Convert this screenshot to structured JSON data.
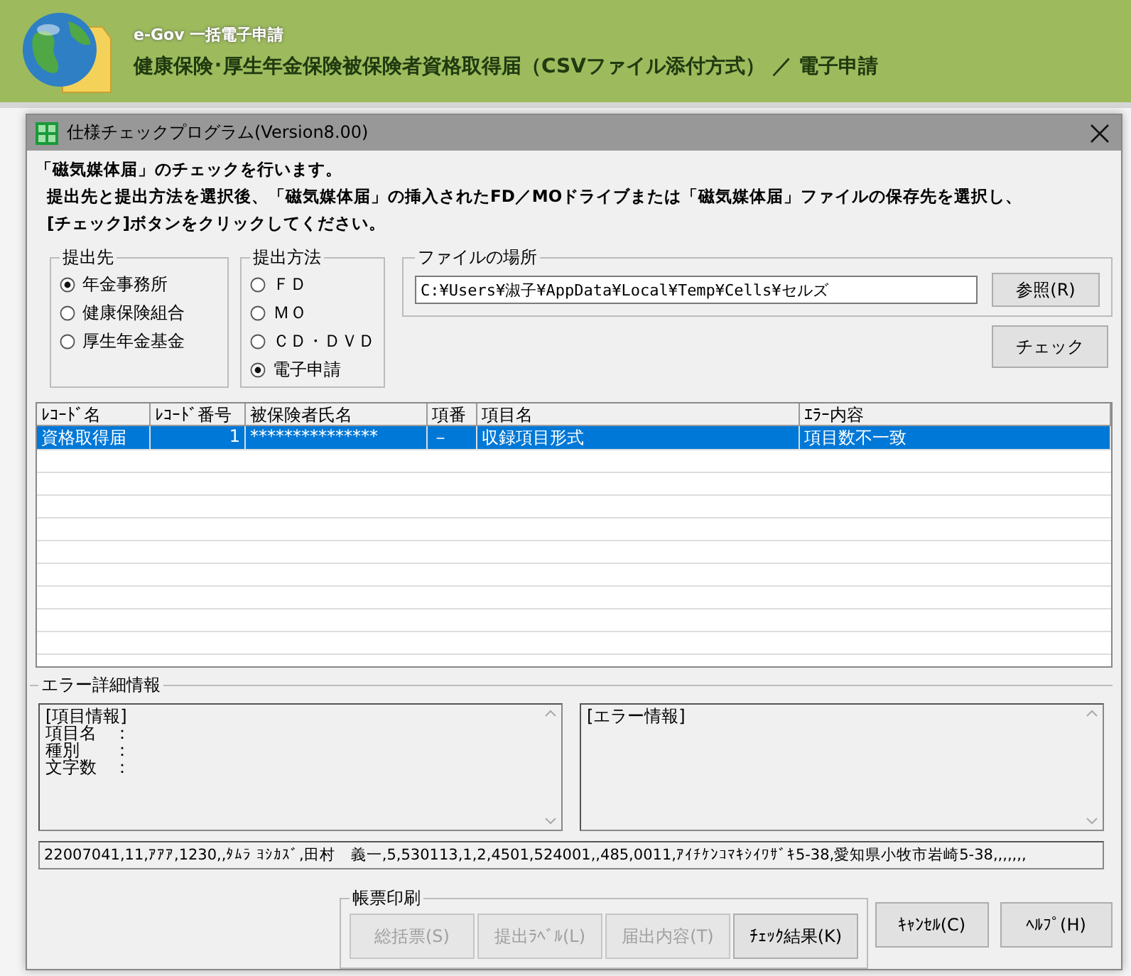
{
  "header": {
    "app_name": "e-Gov 一括電子申請",
    "title": "健康保険･厚生年金保険被保険者資格取得届（CSVファイル添付方式） ／ 電子申請"
  },
  "dialog": {
    "title": "仕様チェックプログラム(Version8.00)",
    "intro": [
      "「磁気媒体届」のチェックを行います。",
      "提出先と提出方法を選択後、「磁気媒体届」の挿入されたFD／MOドライブまたは「磁気媒体届」ファイルの保存先を選択し、",
      "[チェック]ボタンをクリックしてください。"
    ],
    "destination": {
      "label": "提出先",
      "options": [
        {
          "label": "年金事務所",
          "selected": true
        },
        {
          "label": "健康保険組合",
          "selected": false
        },
        {
          "label": "厚生年金基金",
          "selected": false
        }
      ]
    },
    "method": {
      "label": "提出方法",
      "options": [
        {
          "label": "ＦＤ",
          "selected": false
        },
        {
          "label": "ＭＯ",
          "selected": false
        },
        {
          "label": "ＣＤ・ＤＶＤ",
          "selected": false
        },
        {
          "label": "電子申請",
          "selected": true
        }
      ]
    },
    "file_location": {
      "label": "ファイルの場所",
      "value": "C:¥Users¥淑子¥AppData¥Local¥Temp¥Cells¥セルズ",
      "browse_button": "参照(R)"
    },
    "check_button": "チェック",
    "table": {
      "columns": [
        "ﾚｺｰﾄﾞ名",
        "ﾚｺｰﾄﾞ番号",
        "被保険者氏名",
        "項番",
        "項目名",
        "ｴﾗｰ内容"
      ],
      "rows": [
        {
          "cells": [
            "資格取得届",
            "1",
            "***************",
            "－",
            "収録項目形式",
            "項目数不一致"
          ],
          "selected": true
        }
      ]
    },
    "error_detail": {
      "label": "エラー詳細情報",
      "item_info": [
        "[項目情報]",
        "項目名　：",
        "種別　　：",
        "文字数　："
      ],
      "error_info": [
        "[エラー情報]"
      ],
      "csv_line": "22007041,11,ｱｱｱ,1230,,ﾀﾑﾗ ﾖｼｶｽﾞ,田村　義一,5,530113,1,2,4501,524001,,485,0011,ｱｲﾁｹﾝｺﾏｷｼｲﾜｻﾞｷ5-38,愛知県小牧市岩崎5-38,,,,,,,"
    },
    "print_group": {
      "label": "帳票印刷",
      "buttons": [
        {
          "label": "総括票(S)",
          "disabled": true
        },
        {
          "label": "提出ﾗﾍﾞﾙ(L)",
          "disabled": true
        },
        {
          "label": "届出内容(T)",
          "disabled": true
        },
        {
          "label": "ﾁｪｯｸ結果(K)",
          "disabled": false
        }
      ]
    },
    "buttons": [
      "ｷｬﾝｾﾙ(C)",
      "ﾍﾙﾌﾟ(H)"
    ]
  }
}
